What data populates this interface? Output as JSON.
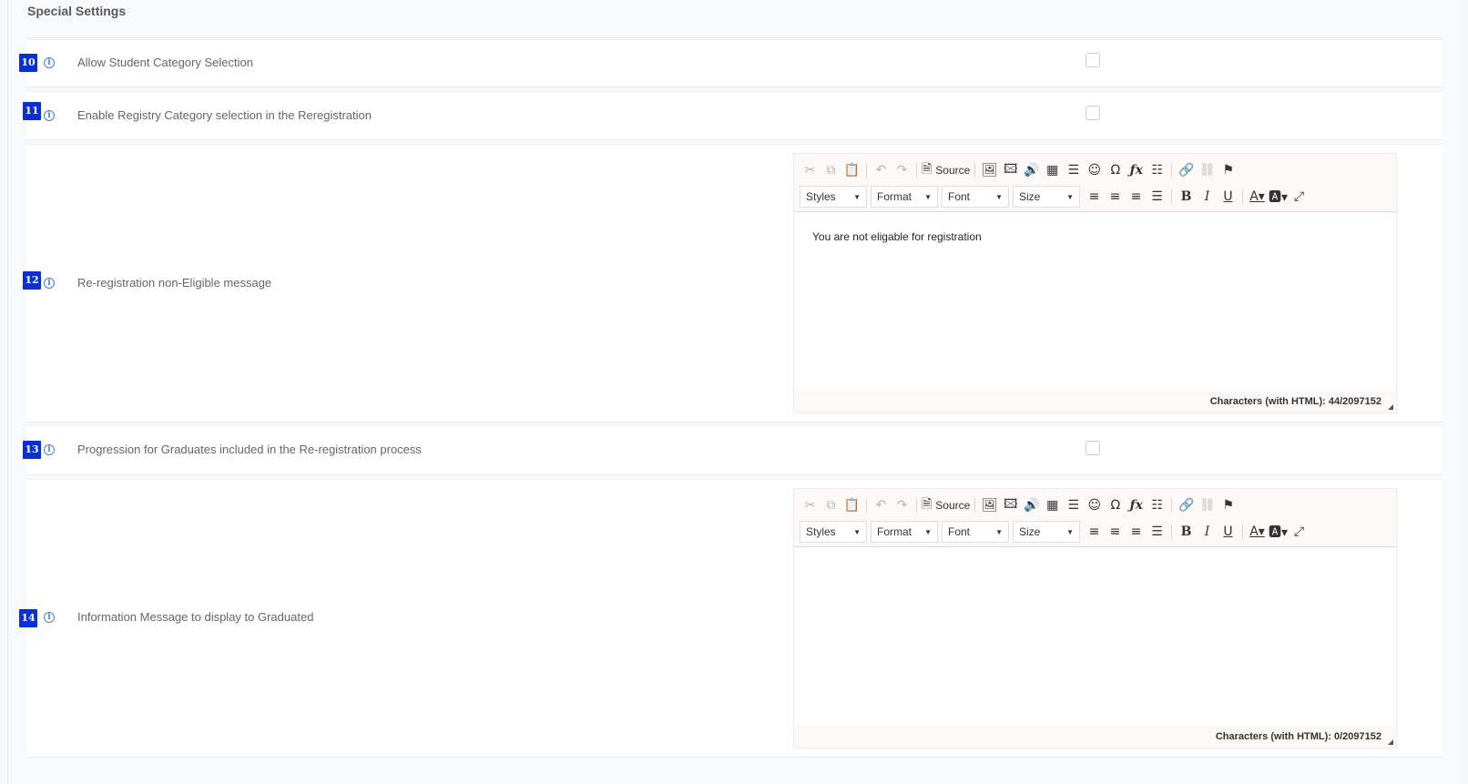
{
  "section": {
    "title": "Special Settings"
  },
  "settings": [
    {
      "number": "10",
      "label": "Allow Student Category Selection",
      "type": "checkbox",
      "checked": false
    },
    {
      "number": "11",
      "label": "Enable Registry Category selection in the Reregistration",
      "type": "checkbox",
      "checked": false
    },
    {
      "number": "12",
      "label": "Re-registration non-Eligible message",
      "type": "editor",
      "content": "You are not eligable for registration",
      "char_count": "Characters (with HTML): 44/2097152"
    },
    {
      "number": "13",
      "label": "Progression for Graduates included in the Re-registration process",
      "type": "checkbox",
      "checked": false
    },
    {
      "number": "14",
      "label": "Information Message to display to Graduated",
      "type": "editor",
      "content": "",
      "char_count": "Characters (with HTML): 0/2097152"
    }
  ],
  "editor_toolbar": {
    "source_label": "Source",
    "styles_label": "Styles",
    "format_label": "Format",
    "font_label": "Font",
    "size_label": "Size"
  },
  "colors": {
    "badge": "#0a2fd6",
    "info": "#4c7bd8"
  }
}
